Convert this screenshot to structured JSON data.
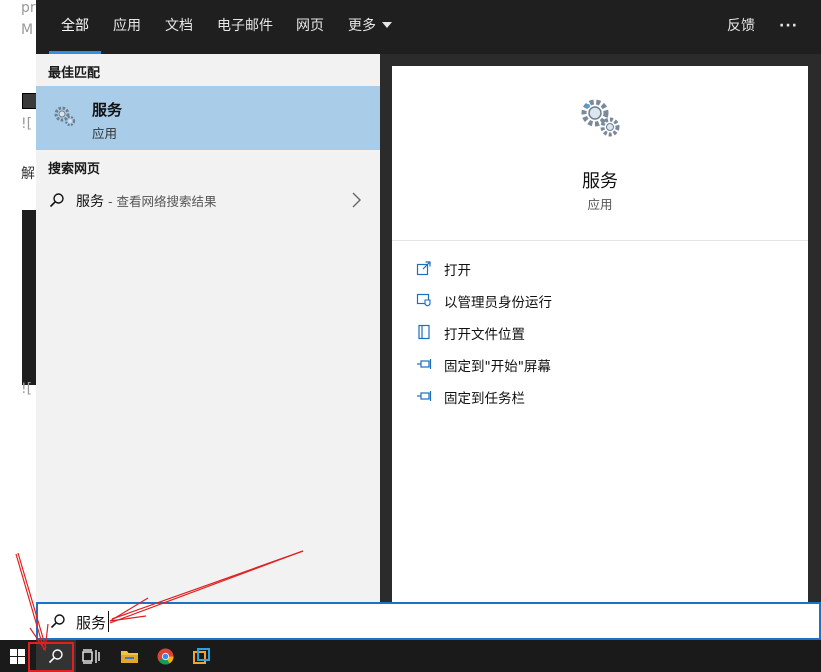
{
  "background": {
    "fragments": [
      "pr",
      "M",
      "![",
      "解",
      "![",
      "![`"
    ]
  },
  "tabs": [
    {
      "label": "全部",
      "active": true
    },
    {
      "label": "应用"
    },
    {
      "label": "文档"
    },
    {
      "label": "电子邮件"
    },
    {
      "label": "网页"
    },
    {
      "label": "更多"
    }
  ],
  "header_right": {
    "feedback_label": "反馈",
    "more_label": "···"
  },
  "best_match": {
    "section_title": "最佳匹配",
    "name": "服务",
    "type": "应用"
  },
  "web_search": {
    "section_title": "搜索网页",
    "query": "服务",
    "hint": " - 查看网络搜索结果"
  },
  "detail": {
    "title": "服务",
    "subtitle": "应用",
    "actions": [
      {
        "label": "打开",
        "icon": "open-icon"
      },
      {
        "label": "以管理员身份运行",
        "icon": "shield-icon"
      },
      {
        "label": "打开文件位置",
        "icon": "file-location-icon"
      },
      {
        "label": "固定到\"开始\"屏幕",
        "icon": "pin-icon"
      },
      {
        "label": "固定到任务栏",
        "icon": "pin-icon"
      }
    ]
  },
  "search_box": {
    "value": "服务"
  },
  "taskbar": {
    "items": [
      "windows-start-icon",
      "search-icon",
      "task-view-icon",
      "file-explorer-icon",
      "chrome-icon",
      "app-icon"
    ]
  },
  "colors": {
    "accent": "#2f8fe6",
    "selection": "#a9cde9",
    "annotation": "#e02020",
    "topbar": "#1f1f1f"
  }
}
